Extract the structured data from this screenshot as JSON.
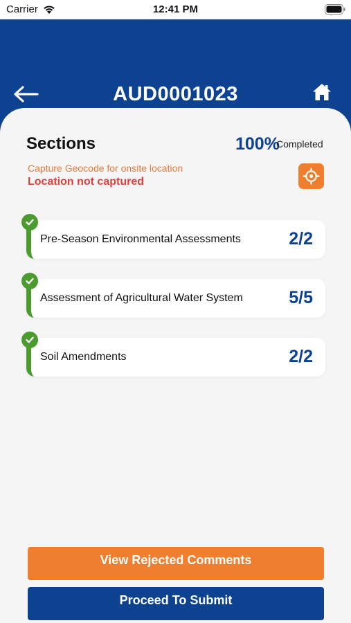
{
  "status_bar": {
    "carrier": "Carrier",
    "time": "12:41 PM"
  },
  "header": {
    "title": "AUD0001023",
    "back_icon": "arrow-left-icon",
    "home_icon": "home-icon",
    "background_color": "#0d4290"
  },
  "sections_panel": {
    "title": "Sections",
    "progress_percent": "100%",
    "progress_label": "Completed",
    "geocode_hint": "Capture Geocode for onsite location",
    "geocode_status": "Location not captured",
    "geocode_icon": "crosshair-icon"
  },
  "sections": [
    {
      "label": "Pre-Season Environmental Assessments",
      "count": "2/2",
      "status": "complete"
    },
    {
      "label": "Assessment of Agricultural Water System",
      "count": "5/5",
      "status": "complete"
    },
    {
      "label": "Soil Amendments",
      "count": "2/2",
      "status": "complete"
    }
  ],
  "actions": {
    "view_rejected_label": "View Rejected Comments",
    "submit_label": "Proceed To Submit"
  },
  "colors": {
    "primary": "#0d4290",
    "accent": "#ef7f2e",
    "success": "#4c9b2f",
    "error": "#e0403d"
  }
}
